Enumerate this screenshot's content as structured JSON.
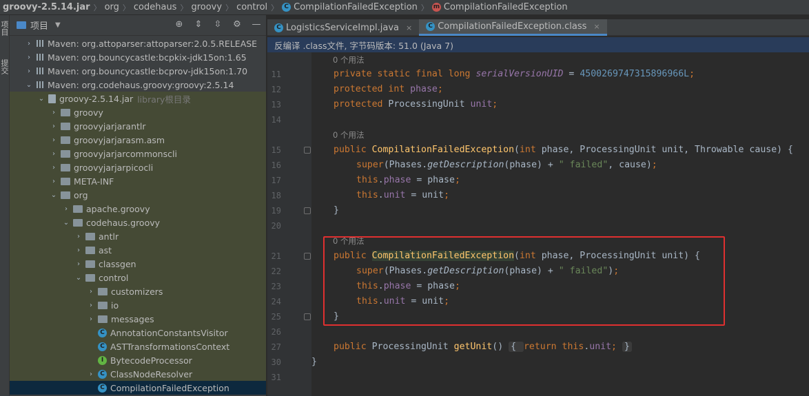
{
  "breadcrumb": [
    {
      "label": "groovy-2.5.14.jar",
      "bold": true,
      "icon": ""
    },
    {
      "label": "org",
      "icon": ""
    },
    {
      "label": "codehaus",
      "icon": ""
    },
    {
      "label": "groovy",
      "icon": ""
    },
    {
      "label": "control",
      "icon": ""
    },
    {
      "label": "CompilationFailedException",
      "icon": "class-icon"
    },
    {
      "label": "CompilationFailedException",
      "icon": "method-icon"
    }
  ],
  "toolstrip": {
    "project_tab": "项目",
    "commit_tab": "提交"
  },
  "project_panel": {
    "title": "项目",
    "tools": [
      "target-icon",
      "expand-all-icon",
      "collapse-all-icon",
      "gear-icon",
      "minimize-icon"
    ],
    "tree": [
      {
        "label": "Maven: org.attoparser:attoparser:2.0.5.RELEASE",
        "arrow": "›"
      },
      {
        "label": "Maven: org.bouncycastle:bcpkix-jdk15on:1.65",
        "arrow": "›"
      },
      {
        "label": "Maven: org.bouncycastle:bcprov-jdk15on:1.70",
        "arrow": "›"
      },
      {
        "label": "Maven: org.codehaus.groovy:groovy:2.5.14",
        "arrow": "⌄"
      },
      {
        "label": "groovy-2.5.14.jar",
        "suffix": "library根目录",
        "arrow": "⌄"
      },
      {
        "label": "groovy",
        "arrow": "›"
      },
      {
        "label": "groovyjarjarantlr",
        "arrow": "›"
      },
      {
        "label": "groovyjarjarasm.asm",
        "arrow": "›"
      },
      {
        "label": "groovyjarjarcommonscli",
        "arrow": "›"
      },
      {
        "label": "groovyjarjarpicocli",
        "arrow": "›"
      },
      {
        "label": "META-INF",
        "arrow": "›"
      },
      {
        "label": "org",
        "arrow": "⌄"
      },
      {
        "label": "apache.groovy",
        "arrow": "›"
      },
      {
        "label": "codehaus.groovy",
        "arrow": "⌄"
      },
      {
        "label": "antlr",
        "arrow": "›"
      },
      {
        "label": "ast",
        "arrow": "›"
      },
      {
        "label": "classgen",
        "arrow": "›"
      },
      {
        "label": "control",
        "arrow": "⌄"
      },
      {
        "label": "customizers",
        "arrow": "›"
      },
      {
        "label": "io",
        "arrow": "›"
      },
      {
        "label": "messages",
        "arrow": "›"
      },
      {
        "label": "AnnotationConstantsVisitor",
        "arrow": ""
      },
      {
        "label": "ASTTransformationsContext",
        "arrow": ""
      },
      {
        "label": "BytecodeProcessor",
        "arrow": ""
      },
      {
        "label": "ClassNodeResolver",
        "arrow": "›"
      },
      {
        "label": "CompilationFailedException",
        "arrow": ""
      }
    ]
  },
  "tabs": [
    {
      "label": "LogisticsServiceImpl.java",
      "close": "×"
    },
    {
      "label": "CompilationFailedException.class",
      "close": "×"
    }
  ],
  "banner": "反编译 .class文件, 字节码版本: 51.0 (Java 7)",
  "usages_hint": "0 个用法",
  "line_numbers": [
    "11",
    "12",
    "13",
    "14",
    "15",
    "16",
    "17",
    "18",
    "19",
    "20",
    "21",
    "22",
    "23",
    "24",
    "25",
    "26",
    "27",
    "30",
    "31"
  ],
  "code": {
    "l11_a": "private static final long ",
    "l11_b": "serialVersionUID",
    "l11_c": " = ",
    "l11_d": "4500269747315896966L",
    "l11_e": ";",
    "l12_a": "protected int ",
    "l12_b": "phase",
    "l12_c": ";",
    "l13_a": "protected ",
    "l13_b": "ProcessingUnit ",
    "l13_c": "unit",
    "l13_d": ";",
    "l15_a": "public ",
    "l15_b": "CompilationFailedException",
    "l15_c": "(",
    "l15_d": "int ",
    "l15_e": "phase, ProcessingUnit unit, Throwable cause) {",
    "l16_a": "super",
    "l16_b": "(Phases.",
    "l16_c": "getDescription",
    "l16_d": "(phase) + ",
    "l16_e": "\" failed\"",
    "l16_f": ", cause)",
    "l16_g": ";",
    "l17_a": "this",
    "l17_b": ".",
    "l17_c": "phase",
    "l17_d": " = phase",
    "l17_e": ";",
    "l18_a": "this",
    "l18_b": ".",
    "l18_c": "unit",
    "l18_d": " = unit",
    "l18_e": ";",
    "l19": "}",
    "l21_a": "public ",
    "l21_b1": "Compila",
    "l21_b2": "tionFailedException",
    "l21_c": "(",
    "l21_d": "int ",
    "l21_e": "phase, ProcessingUnit unit) {",
    "l22_a": "super",
    "l22_b": "(Phases.",
    "l22_c": "getDescription",
    "l22_d": "(phase) + ",
    "l22_e": "\" failed\"",
    "l22_f": ")",
    "l22_g": ";",
    "l23_a": "this",
    "l23_b": ".",
    "l23_c": "phase",
    "l23_d": " = phase",
    "l23_e": ";",
    "l24_a": "this",
    "l24_b": ".",
    "l24_c": "unit",
    "l24_d": " = unit",
    "l24_e": ";",
    "l25": "}",
    "l27_a": "public ",
    "l27_b": "ProcessingUnit ",
    "l27_c": "getUnit",
    "l27_d": "() ",
    "l27_e": "{ ",
    "l27_f": "return this",
    "l27_g": ".",
    "l27_h": "unit",
    "l27_i": "; ",
    "l27_j": "}",
    "l30": "}"
  },
  "colors": {
    "keyword": "#cc7832",
    "method": "#ffc66d",
    "field": "#9876aa",
    "number": "#6897bb",
    "string": "#6a8759",
    "highlight_box": "#e03030"
  }
}
